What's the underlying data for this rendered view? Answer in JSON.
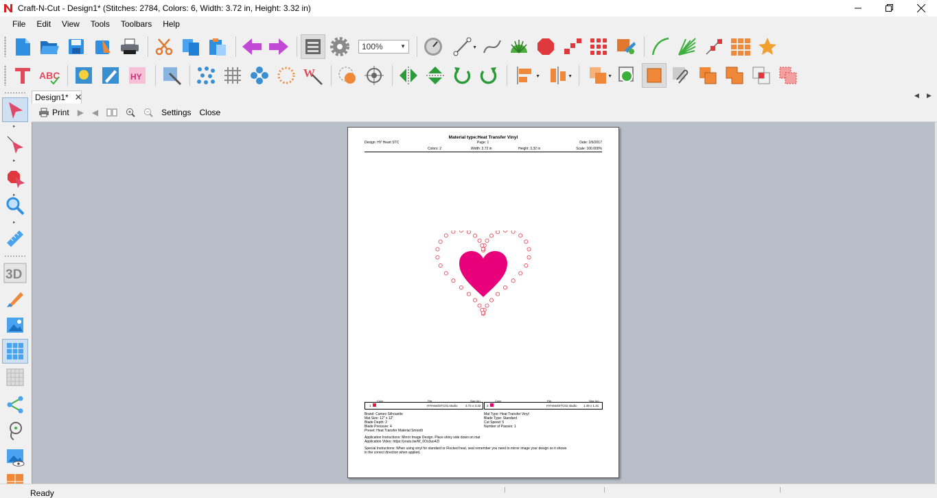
{
  "window": {
    "title": "Craft-N-Cut - Design1* (Stitches: 2784, Colors: 6, Width: 3.72 in, Height: 3.32 in)"
  },
  "menu": [
    "File",
    "Edit",
    "View",
    "Tools",
    "Toolbars",
    "Help"
  ],
  "toolbar": {
    "zoom_value": "100%"
  },
  "tabs": {
    "active_label": "Design1*"
  },
  "preview_toolbar": {
    "print_label": "Print",
    "settings_label": "Settings",
    "close_label": "Close"
  },
  "page": {
    "title": "Material type:Heat Transfer Vinyl",
    "design": "Design: HY Heart STC",
    "page_no": "Page: 1",
    "date": "Date: 2/6/2017",
    "colors": "Colors: 2",
    "width": "Width: 3.72 in",
    "height": "Height: 3.32 in",
    "scale": "Scale: 100.000%",
    "heart_outline_color": "#e8505e",
    "heart_fill_color": "#e8007a",
    "table_headers": {
      "color": "Color",
      "file": "File",
      "size": "Size (in)"
    },
    "color_table": [
      {
        "num": "1",
        "swatch": "#e02040",
        "file": "HYHeartSTC01.studio",
        "size": "3.72 x 3.32"
      },
      {
        "num": "2",
        "swatch": "#e0006e",
        "file": "HYHeartSTC02.studio",
        "size": "1.49 x 1.31"
      }
    ],
    "left_info": [
      "Brand: Cameo Silhouette",
      "Mat Size: 12\" x 12\"",
      "Blade Depth: 2",
      "Blade Pressure: 4",
      "Preset: Heat Transfer Material Smooth"
    ],
    "right_info": [
      "Mat Type: Heat Transfer Vinyl",
      "Blade Type: Standard",
      "Cut Speed: 5",
      "Number of Passes: 1"
    ],
    "app_instructions": "Application Instructions: Mirror Image Design.  Place shiny side down on mat",
    "app_video": "Application Video: https://youtu.be/W_0Os3uo4ZI",
    "special_instructions_1": "Special Instructions: When using vinyl for standard or Flocked heat, seal remember you need to mirror image your design so it shows",
    "special_instructions_2": "in the correct direction when applied."
  },
  "status": {
    "text": "Ready"
  }
}
